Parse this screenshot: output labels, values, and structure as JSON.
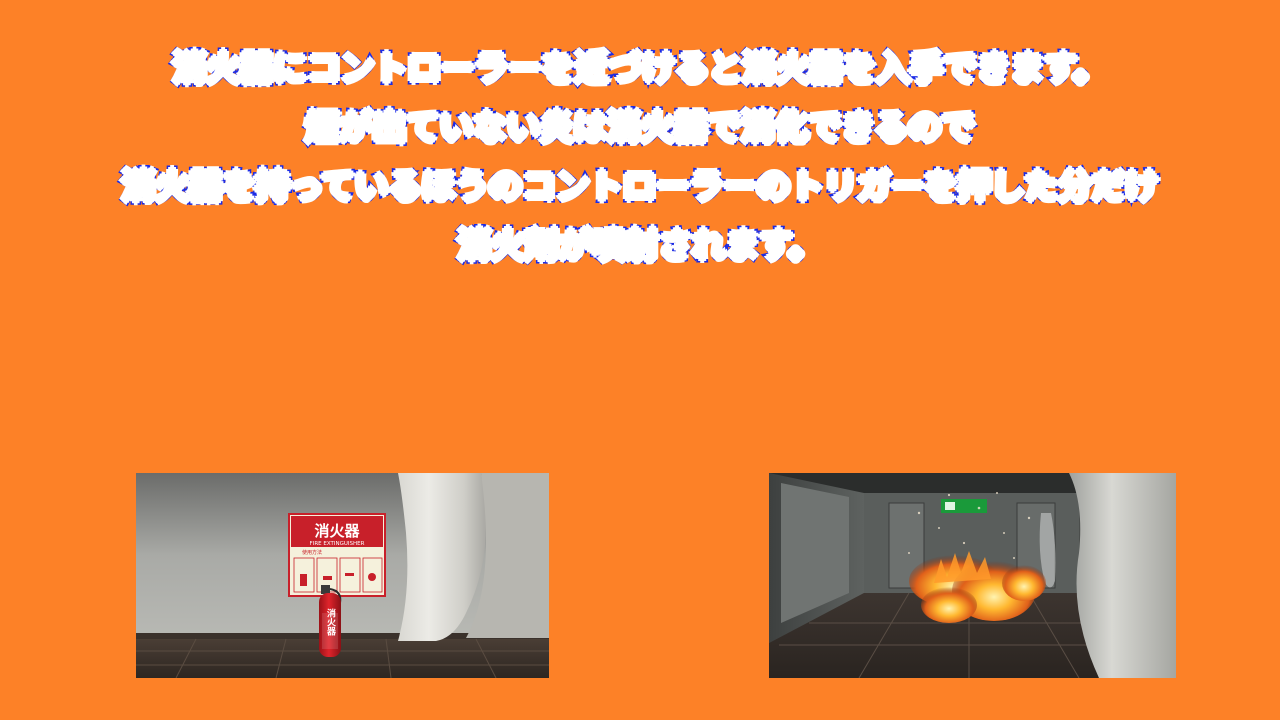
{
  "instructions": {
    "lines": [
      "消火器にコントローラーを近づけると消火器を入手できます。",
      "煙が出ていない炎は消火器で消化できるので",
      "消火器を持っているほうのコントローラーのトリガーを押した分だけ",
      "消火剤が噴射されます。"
    ]
  },
  "screenshot_left": {
    "sign_title": "消火器",
    "sign_subtitle": "FIRE EXTINGUISHER",
    "sign_caption": "使用方法",
    "extinguisher_label": "消火器"
  },
  "screenshot_right": {},
  "colors": {
    "background": "#fd8127",
    "text_fill": "#ffffff",
    "text_outline": "#1a2ae6",
    "sign_red": "#c8202a",
    "exit_green": "#1a9a3a"
  }
}
